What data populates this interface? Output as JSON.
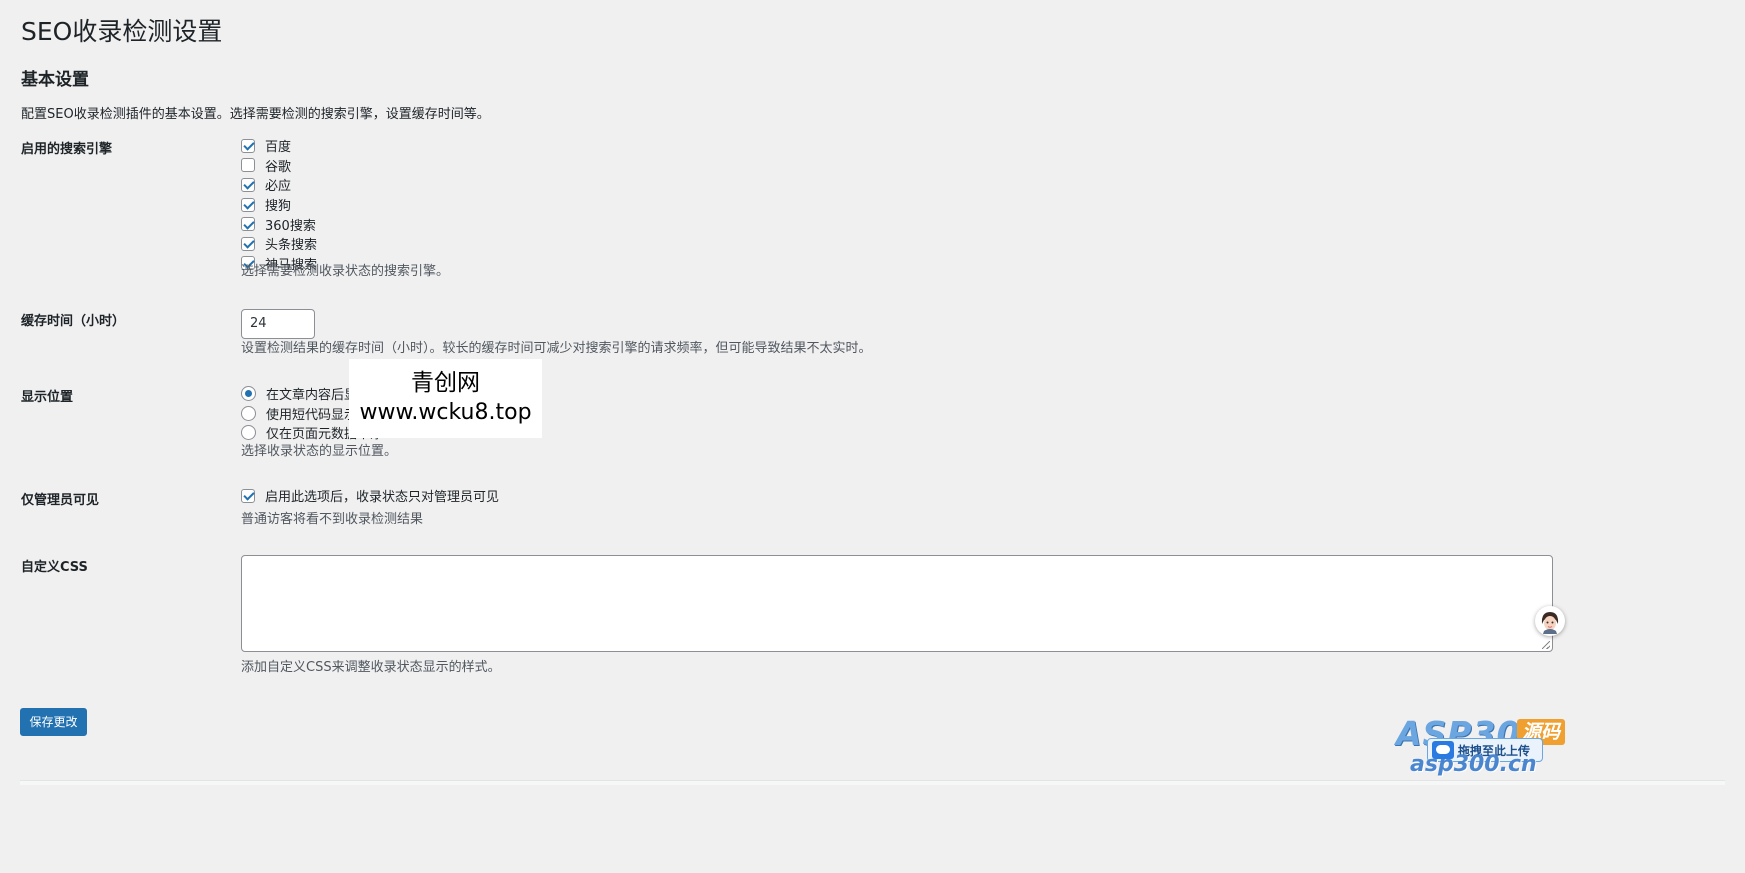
{
  "page": {
    "title": "SEO收录检测设置"
  },
  "section": {
    "title": "基本设置",
    "description": "配置SEO收录检测插件的基本设置。选择需要检测的搜索引擎，设置缓存时间等。"
  },
  "engines": {
    "label": "启用的搜索引擎",
    "options": [
      {
        "label": "百度",
        "checked": true
      },
      {
        "label": "谷歌",
        "checked": false
      },
      {
        "label": "必应",
        "checked": true
      },
      {
        "label": "搜狗",
        "checked": true
      },
      {
        "label": "360搜索",
        "checked": true
      },
      {
        "label": "头条搜索",
        "checked": true
      },
      {
        "label": "神马搜索",
        "checked": true
      }
    ],
    "description": "选择需要检测收录状态的搜索引擎。"
  },
  "cache": {
    "label": "缓存时间（小时）",
    "value": "24",
    "description": "设置检测结果的缓存时间（小时）。较长的缓存时间可减少对搜索引擎的请求频率，但可能导致结果不太实时。"
  },
  "display": {
    "label": "显示位置",
    "options": [
      {
        "label": "在文章内容后显示",
        "checked": true
      },
      {
        "label": "使用短代码显示 [sec",
        "checked": false
      },
      {
        "label": "仅在页面元数据中添",
        "checked": false
      }
    ],
    "description": "选择收录状态的显示位置。"
  },
  "admin_only": {
    "label": "仅管理员可见",
    "option_label": "启用此选项后，收录状态只对管理员可见",
    "checked": true,
    "description": "普通访客将看不到收录检测结果"
  },
  "custom_css": {
    "label": "自定义CSS",
    "value": "",
    "description": "添加自定义CSS来调整收录状态显示的样式。"
  },
  "save_button": {
    "label": "保存更改"
  },
  "watermark": {
    "line1": "青创网",
    "line2": "www.wcku8.top"
  },
  "overlay_logo": {
    "brand": "ASP300",
    "badge": "源码",
    "upload_label": "拖拽至此上传",
    "domain": "asp300.cn"
  },
  "colors": {
    "background": "#f0f0f1",
    "accent": "#2271b1",
    "text": "#1d2327",
    "muted_text": "#50575e"
  }
}
